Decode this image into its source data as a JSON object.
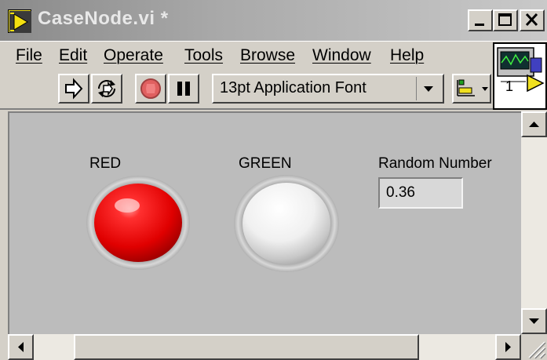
{
  "window": {
    "title": "CaseNode.vi *",
    "minimize_icon": "minimize-icon",
    "maximize_icon": "maximize-icon",
    "close_icon": "close-icon"
  },
  "menu": {
    "items": [
      {
        "label": "File"
      },
      {
        "label": "Edit"
      },
      {
        "label": "Operate"
      },
      {
        "label": "Tools"
      },
      {
        "label": "Browse"
      },
      {
        "label": "Window"
      },
      {
        "label": "Help"
      }
    ]
  },
  "toolbar": {
    "run_icon": "run-arrow-icon",
    "run_continuous_icon": "run-continuously-icon",
    "abort_icon": "abort-stop-icon",
    "pause_icon": "pause-icon",
    "font_selector": "13pt Application Font",
    "align_icon": "align-objects-icon",
    "connector_pane_number": "1"
  },
  "panel": {
    "leds": [
      {
        "label": "RED",
        "state": "on",
        "color": "#ee1111"
      },
      {
        "label": "GREEN",
        "state": "off",
        "color": "#f4f4f4"
      }
    ],
    "numeric_indicator": {
      "label": "Random Number",
      "value": "0.36"
    }
  },
  "colors": {
    "panel_background": "#bcbcbc",
    "window_chrome": "#d4d0c8",
    "led_red_on": "#ee1111",
    "led_off": "#f4f4f4"
  }
}
